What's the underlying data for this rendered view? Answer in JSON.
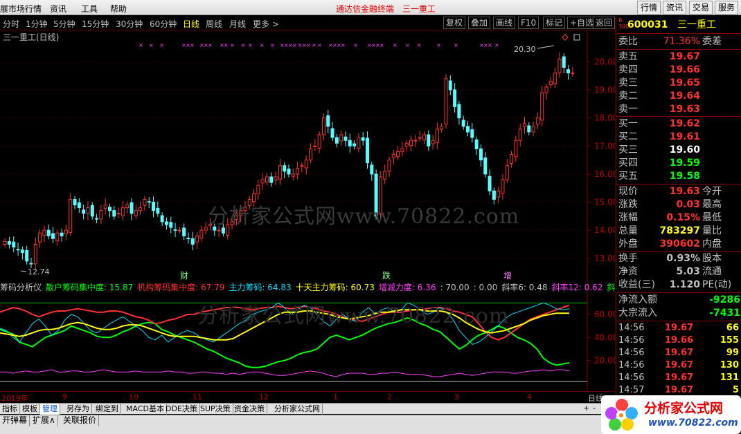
{
  "menubar": {
    "items": [
      "展市场行情",
      "资讯",
      "工具",
      "帮助"
    ],
    "title": "通达信金融终端　三一重工",
    "right_buttons": [
      "行情",
      "资讯",
      "交易",
      "服务"
    ]
  },
  "periods": {
    "items": [
      "分时",
      "1分钟",
      "5分钟",
      "15分钟",
      "30分钟",
      "60分钟",
      "日线",
      "周线",
      "月线",
      "更多 >"
    ],
    "active": "日线"
  },
  "toolbar": [
    "复权",
    "叠加",
    "画线",
    "F10",
    "标记",
    "+自选",
    "返回"
  ],
  "chart_title": "三一重工(日线)",
  "price_axis": [
    "20.00",
    "19.00",
    "18.00",
    "17.00",
    "16.00",
    "15.00",
    "14.00",
    "13.00"
  ],
  "ind_axis": [
    "60.00",
    "40.00",
    "20.00"
  ],
  "annotations": {
    "high": "20.30",
    "low": "12.74",
    "events": [
      "财",
      "跌",
      "增"
    ]
  },
  "indicator_header": [
    {
      "text": "筹码分析仪",
      "color": "#c0c0c0"
    },
    {
      "text": "散户筹码集中度: 15.87",
      "color": "#00ff00"
    },
    {
      "text": "机构筹码集中度: 67.79",
      "color": "#ff3030"
    },
    {
      "text": "主力筹码: 64.83",
      "color": "#00e0ff"
    },
    {
      "text": "十天主力筹码: 60.73",
      "color": "#ffff00"
    },
    {
      "text": "增减力度: 6.36",
      "color": "#ff40ff"
    },
    {
      "text": ": 70.00",
      "color": "#c0c0c0"
    },
    {
      "text": ": 0.00",
      "color": "#c0c0c0"
    },
    {
      "text": "斜率6: 0.48",
      "color": "#c0c0c0"
    },
    {
      "text": "斜率12: 0.62",
      "color": "#ff40ff"
    },
    {
      "text": "斜率",
      "color": "#00ff00"
    }
  ],
  "time_axis": [
    "2019年",
    "9",
    "10",
    "11",
    "12",
    "1",
    "2",
    "3",
    "4"
  ],
  "time_axis_right": "日线",
  "quote": {
    "badge": "R 300",
    "code": "600031",
    "name": "三一重工",
    "weibi_label": "委比",
    "weibi_value": "71.36%",
    "weicha_label": "委差",
    "asks": [
      {
        "label": "卖五",
        "price": "19.67"
      },
      {
        "label": "卖四",
        "price": "19.66"
      },
      {
        "label": "卖三",
        "price": "19.65"
      },
      {
        "label": "卖二",
        "price": "19.64"
      },
      {
        "label": "卖一",
        "price": "19.63"
      }
    ],
    "bids": [
      {
        "label": "买一",
        "price": "19.62",
        "color": "#ff3030"
      },
      {
        "label": "买二",
        "price": "19.61",
        "color": "#ff3030"
      },
      {
        "label": "买三",
        "price": "19.60",
        "color": "#ffffff"
      },
      {
        "label": "买四",
        "price": "19.59",
        "color": "#00ff00"
      },
      {
        "label": "买五",
        "price": "19.58",
        "color": "#00ff00"
      }
    ],
    "stats": [
      {
        "l": "现价",
        "v": "19.63",
        "vc": "#ff3030",
        "r": "今开"
      },
      {
        "l": "涨跌",
        "v": "0.03",
        "vc": "#ff3030",
        "r": "最高"
      },
      {
        "l": "涨幅",
        "v": "0.15%",
        "vc": "#ff3030",
        "r": "最低"
      },
      {
        "l": "总量",
        "v": "783297",
        "vc": "#ffff00",
        "r": "量比"
      },
      {
        "l": "外盘",
        "v": "390602",
        "vc": "#ff3030",
        "r": "内盘"
      }
    ],
    "stats2": [
      {
        "l": "换手",
        "v": "0.93%",
        "vc": "#c0c0c0",
        "r": "股本"
      },
      {
        "l": "净资",
        "v": "5.03",
        "vc": "#c0c0c0",
        "r": "流通"
      },
      {
        "l": "收益(三)",
        "v": "1.120",
        "vc": "#c0c0c0",
        "r": "PE(动)"
      }
    ],
    "flows": [
      {
        "l": "净流入额",
        "v": "-9286"
      },
      {
        "l": "大宗流入",
        "v": "-7431"
      }
    ],
    "ticks": [
      {
        "t": "14:56",
        "p": "19.67",
        "v": "66"
      },
      {
        "t": "14:56",
        "p": "19.66",
        "v": "155"
      },
      {
        "t": "14:56",
        "p": "19.67",
        "v": "99"
      },
      {
        "t": "14:56",
        "p": "19.67",
        "v": "130"
      },
      {
        "t": "14:56",
        "p": "19.67",
        "v": "131"
      },
      {
        "t": "14:57",
        "p": "19.67",
        "v": "5"
      }
    ]
  },
  "bottom_tabs": [
    "指标",
    "模板",
    "管理",
    "另存为",
    "绑定到",
    "MACD基本",
    "DDE决策",
    "SUP决策",
    "资金决策",
    "分析家公式网"
  ],
  "bottom_tabs_active": "管理",
  "bottom_bar": [
    "开弹幕",
    "扩展∧",
    "关联报价"
  ],
  "watermark": "分析家公式网www.70822.com",
  "logo": {
    "title": "分析家公式网",
    "url": "www.70822.com"
  },
  "chart_data": {
    "type": "candlestick",
    "title": "三一重工(日线)",
    "ylim": [
      12.6,
      20.6
    ],
    "ohlc_note": "daily OHLC estimated from chart, from Aug 2019 to Apr 2020",
    "close": [
      13.6,
      13.5,
      13.4,
      13.3,
      13.2,
      12.9,
      12.8,
      13.5,
      13.9,
      14.0,
      13.8,
      13.7,
      13.9,
      13.8,
      14.0,
      15.1,
      14.9,
      14.8,
      14.6,
      14.8,
      14.5,
      14.4,
      14.7,
      14.9,
      14.7,
      14.5,
      14.6,
      14.8,
      14.9,
      14.6,
      14.7,
      14.8,
      15.1,
      15.0,
      14.7,
      14.6,
      14.3,
      14.2,
      14.1,
      14.0,
      14.0,
      13.8,
      13.7,
      13.5,
      13.8,
      14.0,
      14.1,
      14.2,
      14.0,
      14.0,
      13.9,
      14.2,
      14.3,
      14.6,
      14.7,
      14.8,
      15.1,
      15.3,
      15.6,
      15.8,
      15.9,
      15.7,
      15.9,
      16.3,
      16.1,
      16.0,
      16.0,
      16.2,
      16.3,
      16.5,
      16.9,
      17.0,
      17.4,
      18.0,
      17.7,
      17.3,
      17.1,
      17.4,
      17.2,
      17.0,
      17.0,
      17.3,
      17.2,
      16.4,
      16.0,
      14.5,
      15.9,
      16.1,
      16.5,
      16.7,
      16.8,
      16.9,
      17.1,
      17.2,
      17.2,
      17.3,
      17.4,
      17.0,
      17.2,
      17.6,
      17.7,
      19.4,
      19.0,
      18.4,
      18.0,
      17.7,
      17.5,
      17.3,
      16.9,
      16.5,
      16.0,
      15.4,
      15.1,
      15.4,
      15.8,
      16.3,
      16.7,
      17.2,
      17.6,
      17.8,
      17.5,
      17.7,
      18.0,
      18.9,
      19.1,
      19.3,
      19.6,
      20.1,
      19.8,
      19.6,
      19.6
    ],
    "high_label": "20.30",
    "low_label": "12.74",
    "indicator": {
      "series": [
        {
          "name": "散户筹码集中度",
          "color": "#00ff00",
          "values": [
            47,
            45,
            43,
            36,
            34,
            32,
            36,
            40,
            42,
            44,
            46,
            50,
            48,
            46,
            44,
            41,
            40,
            40,
            42,
            45,
            47,
            50,
            52,
            53,
            52,
            47,
            45,
            42,
            40,
            38,
            36,
            33,
            30,
            28,
            25,
            22,
            20,
            18,
            15,
            14,
            14,
            15,
            17,
            19,
            20,
            22,
            25,
            27,
            28,
            30,
            35,
            40,
            42,
            40,
            38,
            40,
            42,
            45,
            48,
            50,
            52,
            53,
            55,
            57,
            55,
            52,
            50,
            47,
            45,
            40,
            35,
            30,
            33,
            38,
            42,
            44,
            47,
            50,
            48,
            44,
            40,
            38,
            35,
            30,
            22,
            18,
            16,
            17,
            18
          ]
        },
        {
          "name": "机构筹码集中度",
          "color": "#ff3030",
          "values": [
            62,
            64,
            66,
            65,
            63,
            60,
            58,
            60,
            62,
            63,
            63,
            64,
            65,
            64,
            63,
            62,
            62,
            63,
            63,
            62,
            60,
            58,
            57,
            55,
            52,
            53,
            55,
            56,
            58,
            60,
            60,
            62,
            63,
            64,
            65,
            66,
            66,
            66,
            65,
            64,
            65,
            66,
            66,
            67,
            66,
            65,
            66,
            67,
            66,
            65,
            63,
            62,
            60,
            58,
            56,
            55,
            54,
            56,
            58,
            60,
            62,
            62,
            62,
            63,
            64,
            64,
            65,
            66,
            66,
            65,
            63,
            62,
            60,
            58,
            52,
            45,
            40,
            38,
            40,
            44,
            48,
            52,
            56,
            58,
            60,
            62,
            64,
            66,
            68
          ]
        },
        {
          "name": "主力筹码",
          "color": "#00e0ff",
          "values": [
            48,
            46,
            40,
            36,
            44,
            52,
            56,
            50,
            42,
            46,
            55,
            60,
            58,
            52,
            46,
            44,
            48,
            52,
            55,
            58,
            54,
            50,
            46,
            40,
            38,
            42,
            36,
            40,
            44,
            46,
            44,
            40,
            38,
            36,
            40,
            44,
            48,
            52,
            55,
            60,
            62,
            64,
            66,
            70,
            66,
            60,
            64,
            68,
            66,
            60,
            54,
            50,
            56,
            60,
            56,
            54,
            62,
            66,
            60,
            64,
            66,
            62,
            64,
            70,
            68,
            64,
            60,
            62,
            66,
            62,
            56,
            46,
            40,
            34,
            36,
            40,
            45,
            50,
            56,
            60,
            62,
            64,
            66,
            68,
            70,
            68,
            65,
            64,
            65
          ]
        },
        {
          "name": "十天主力筹码",
          "color": "#ffff00",
          "values": [
            44,
            43,
            42,
            41,
            42,
            44,
            46,
            47,
            47,
            48,
            50,
            52,
            53,
            52,
            50,
            48,
            47,
            47,
            48,
            50,
            51,
            51,
            50,
            48,
            46,
            44,
            42,
            41,
            41,
            41,
            41,
            40,
            39,
            38,
            38,
            38,
            39,
            42,
            45,
            48,
            51,
            54,
            57,
            60,
            62,
            62,
            62,
            63,
            63,
            62,
            61,
            60,
            58,
            57,
            56,
            57,
            58,
            59,
            61,
            62,
            62,
            63,
            64,
            64,
            64,
            64,
            63,
            63,
            63,
            62,
            60,
            57,
            53,
            50,
            47,
            45,
            44,
            45,
            46,
            48,
            50,
            52,
            55,
            57,
            59,
            60,
            61,
            61,
            61
          ]
        },
        {
          "name": "增减力度",
          "color": "#ff40ff",
          "values": [
            10,
            10,
            9,
            10,
            11,
            10,
            10,
            11,
            12,
            10,
            10,
            11,
            11,
            10,
            10,
            11,
            12,
            11,
            10,
            10,
            10,
            11,
            10,
            10,
            10,
            10,
            11,
            10,
            10,
            9,
            9,
            10,
            10,
            9,
            9,
            8,
            9,
            8,
            9,
            10,
            10,
            9,
            8,
            7,
            7,
            8,
            9,
            10,
            11,
            10,
            9,
            7,
            6,
            8,
            9,
            9,
            9,
            8,
            8,
            9,
            9,
            10,
            9,
            8,
            8,
            8,
            7,
            6,
            6,
            7,
            8,
            9,
            8,
            7,
            8,
            9,
            10,
            10,
            10,
            9,
            9,
            10,
            11,
            11,
            12,
            11,
            12,
            12,
            11
          ]
        }
      ]
    }
  }
}
